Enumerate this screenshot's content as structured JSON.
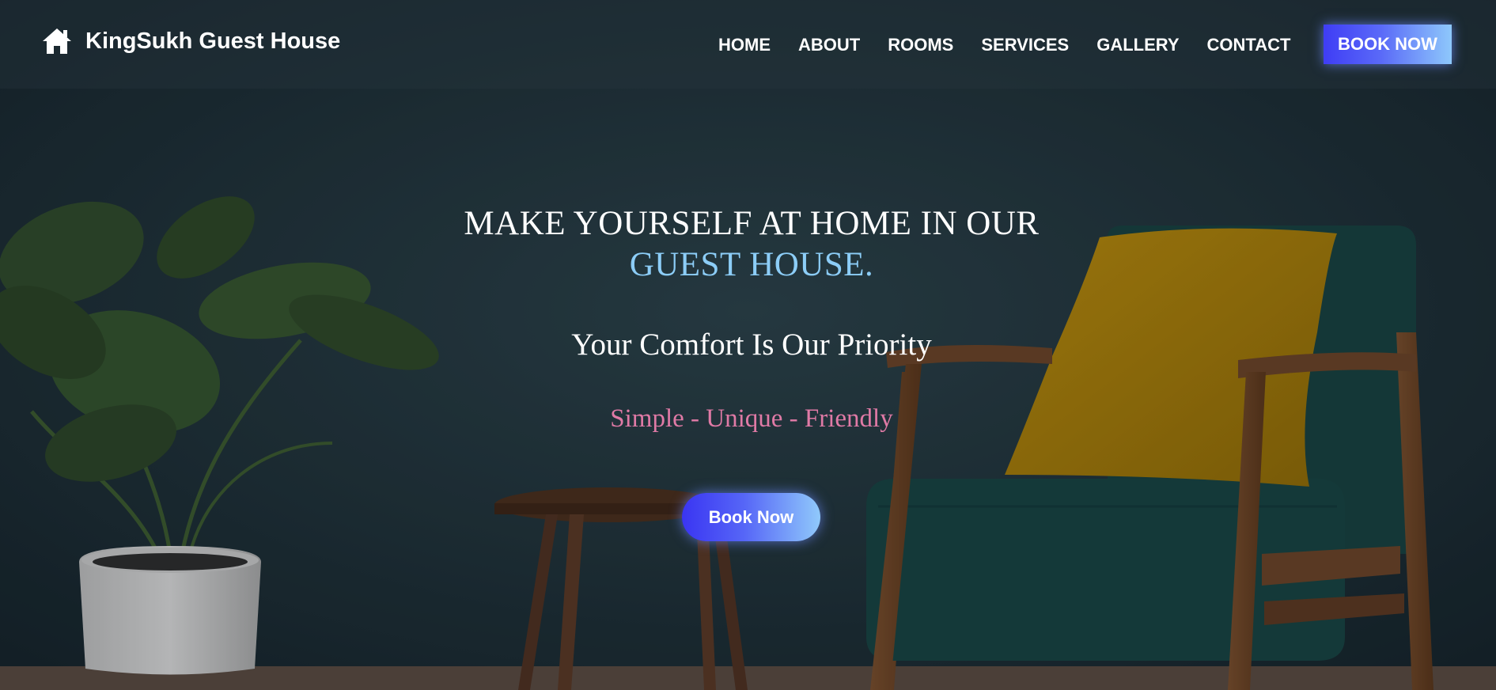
{
  "brand": {
    "icon": "home-icon",
    "name": "KingSukh Guest House"
  },
  "nav": {
    "links": [
      "HOME",
      "ABOUT",
      "ROOMS",
      "SERVICES",
      "GALLERY",
      "CONTACT"
    ],
    "book_label": "BOOK NOW"
  },
  "hero": {
    "headline_line1": "MAKE YOURSELF AT HOME IN OUR",
    "headline_line2": "GUEST HOUSE.",
    "subtitle": "Your Comfort Is Our Priority",
    "tagline": "Simple - Unique - Friendly",
    "book_label": "Book Now"
  },
  "colors": {
    "accent_blue": "#8ccdf7",
    "tagline_pink": "#e07aa6",
    "button_gradient_start": "#3f3df5",
    "button_gradient_end": "#8ec8fb"
  }
}
